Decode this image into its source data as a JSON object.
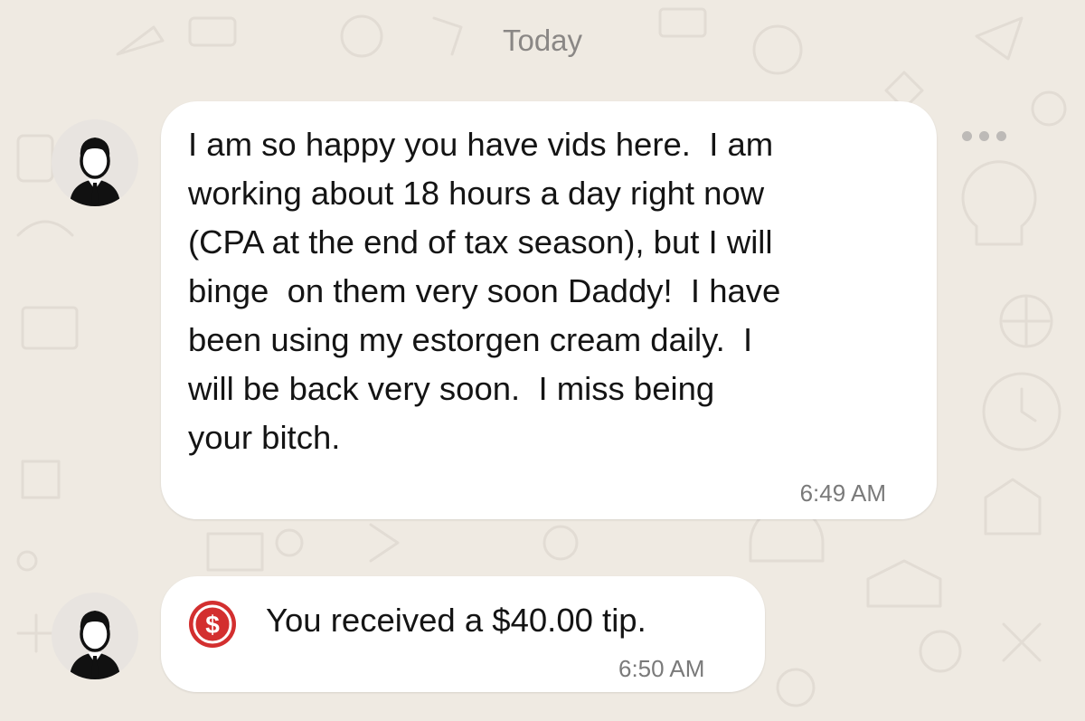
{
  "chat": {
    "date_divider": "Today",
    "more_icon": "more-horizontal-icon",
    "messages": [
      {
        "avatar_icon": "businessman-avatar-icon",
        "text": "I am so happy you have vids here.  I am\nworking about 18 hours a day right now\n(CPA at the end of tax season), but I will\nbinge  on them very soon Daddy!  I have\nbeen using my estorgen cream daily.  I\nwill be back very soon.  I miss being\nyour bitch.",
        "time": "6:49 AM"
      },
      {
        "avatar_icon": "businessman-avatar-icon",
        "tip_icon": "dollar-circle-icon",
        "tip_color": "#d32f2f",
        "text": "You received a $40.00 tip.",
        "time": "6:50 AM"
      }
    ]
  },
  "colors": {
    "background": "#efeae2",
    "bubble": "#ffffff",
    "text": "#141414",
    "muted": "#8a8785"
  }
}
